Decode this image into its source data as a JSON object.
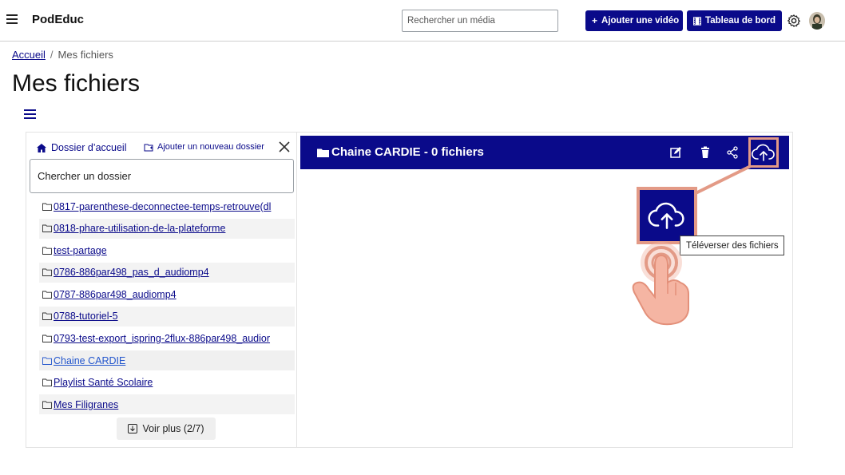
{
  "navbar": {
    "brand": "PodEduc",
    "search_placeholder": "Rechercher un média",
    "add_video_label": "Ajouter une vidéo",
    "dashboard_label": "Tableau de bord"
  },
  "breadcrumb": {
    "home": "Accueil",
    "current": "Mes fichiers"
  },
  "page": {
    "title": "Mes fichiers"
  },
  "sidebar": {
    "home_folder": "Dossier d’accueil",
    "add_folder": "Ajouter un nouveau dossier",
    "search_placeholder": "Chercher un dossier",
    "folders": [
      {
        "label": "0817-parenthese-deconnectee-temps-retrouve(dl"
      },
      {
        "label": "0818-phare-utilisation-de-la-plateforme"
      },
      {
        "label": "test-partage"
      },
      {
        "label": "0786-886par498_pas_d_audiomp4"
      },
      {
        "label": "0787-886par498_audiomp4"
      },
      {
        "label": "0788-tutoriel-5"
      },
      {
        "label": "0793-test-export_ispring-2flux-886par498_audior"
      },
      {
        "label": "Chaine CARDIE"
      },
      {
        "label": "Playlist Santé Scolaire"
      },
      {
        "label": "Mes Filigranes"
      }
    ],
    "more_label": "Voir plus (2/7)"
  },
  "content": {
    "header_title": "Chaine CARDIE - 0 fichiers"
  },
  "overlay": {
    "tooltip": "Téléverser des fichiers"
  },
  "colors": {
    "primary": "#0a0a8a",
    "highlight": "#e39a86"
  }
}
